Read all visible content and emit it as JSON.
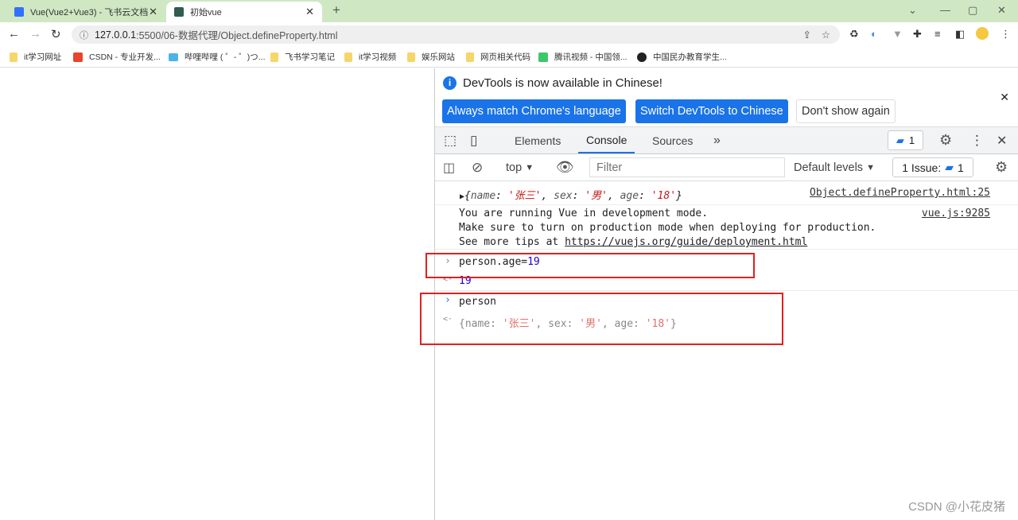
{
  "browser": {
    "tabs": [
      {
        "title": "Vue(Vue2+Vue3) - 飞书云文档",
        "favicon_color": "#3370ff",
        "active": false
      },
      {
        "title": "初始vue",
        "favicon_color": "#2f5d50",
        "active": true
      }
    ],
    "url_host": "127.0.0.1",
    "url_rest": ":5500/06-数据代理/Object.defineProperty.html",
    "bookmarks": [
      "it学习网址",
      "CSDN - 专业开发...",
      "哔哩哔哩 ( ゜- ゜)つ...",
      "飞书学习笔记",
      "it学习视频",
      "娱乐网站",
      "网页相关代码",
      "腾讯视频 - 中国领...",
      "中国民办教育学生..."
    ]
  },
  "devtools": {
    "banner_text": "DevTools is now available in Chinese!",
    "btn_match": "Always match Chrome's language",
    "btn_switch": "Switch DevTools to Chinese",
    "btn_dismiss": "Don't show again",
    "tabs": [
      "Elements",
      "Console",
      "Sources"
    ],
    "active_tab": "Console",
    "issues_badge": "1",
    "context": "top",
    "filter_placeholder": "Filter",
    "levels": "Default levels",
    "issues_label": "1 Issue:",
    "issues_count": "1",
    "accent": "#1a73e8"
  },
  "console": {
    "log1": {
      "name_key": "name",
      "name_val": "'张三'",
      "sex_key": "sex",
      "sex_val": "'男'",
      "age_key": "age",
      "age_val": "'18'",
      "source": "Object.defineProperty.html:25"
    },
    "vue_msg": {
      "line1": "You are running Vue in development mode.",
      "line2": "Make sure to turn on production mode when deploying for production.",
      "line3_prefix": "See more tips at ",
      "link": "https://vuejs.org/guide/deployment.html",
      "source": "vue.js:9285"
    },
    "input1_prefix": "person.age=",
    "input1_num": "19",
    "result1": "19",
    "input2": "person",
    "result2": {
      "name_val": "'张三'",
      "sex_val": "'男'",
      "age_val": "'18'"
    }
  },
  "watermark": "CSDN @小花皮猪"
}
